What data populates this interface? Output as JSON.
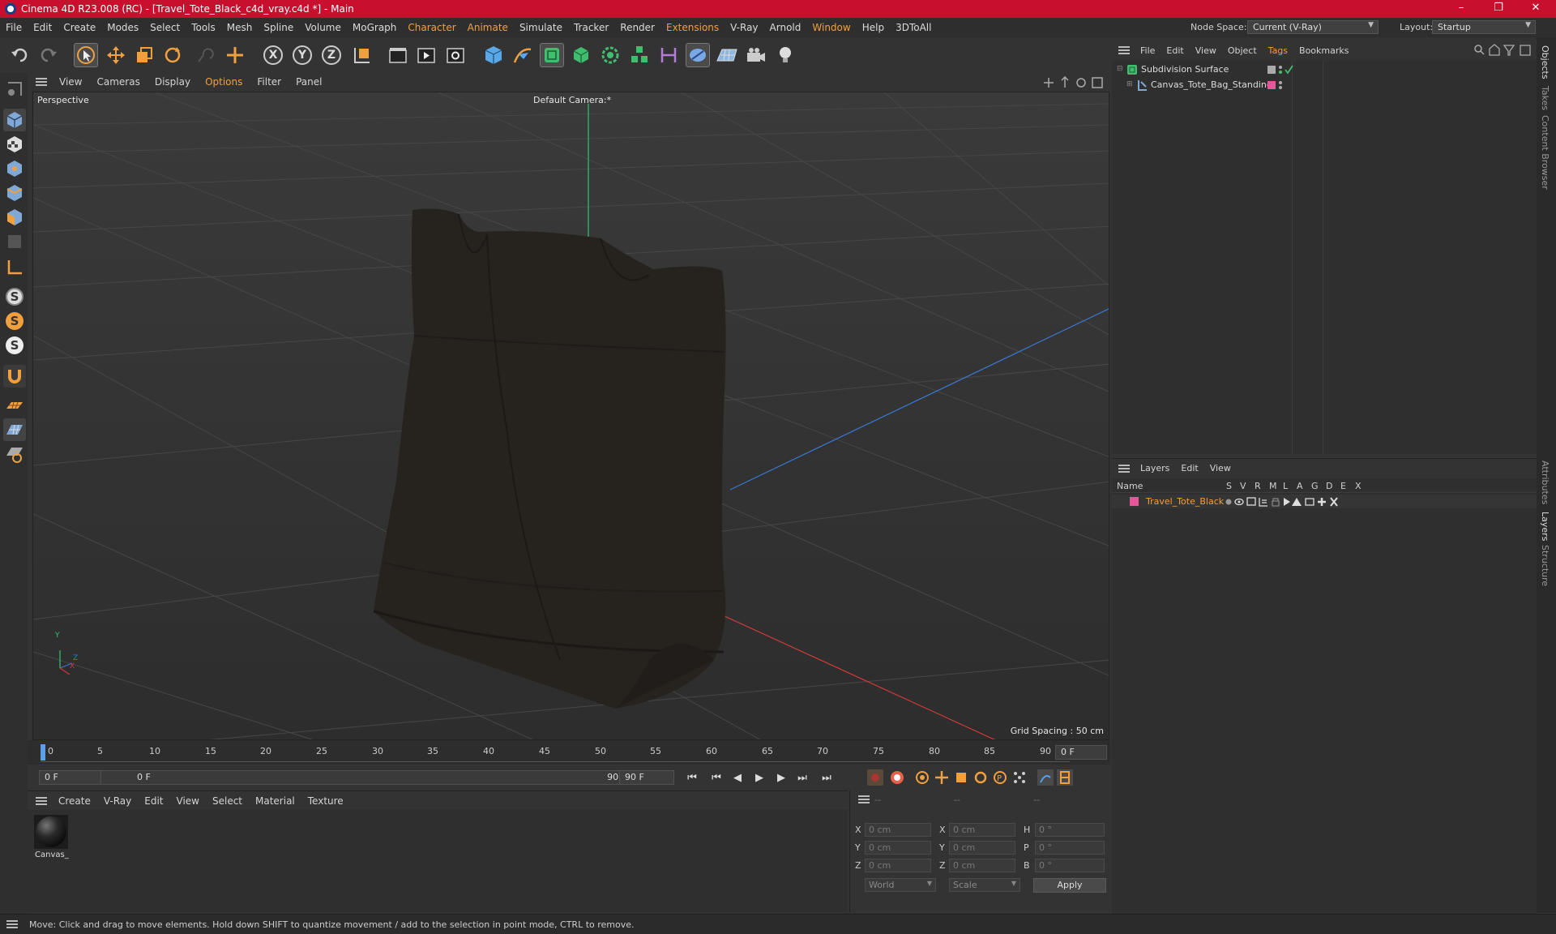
{
  "window": {
    "title": "Cinema 4D R23.008 (RC) - [Travel_Tote_Black_c4d_vray.c4d *] - Main",
    "minimize": "–",
    "restore": "❐",
    "close": "✕"
  },
  "menubar": {
    "items": [
      "File",
      "Edit",
      "Create",
      "Modes",
      "Select",
      "Tools",
      "Mesh",
      "Spline",
      "Volume",
      "MoGraph",
      "Character",
      "Animate",
      "Simulate",
      "Tracker",
      "Render",
      "Extensions",
      "V-Ray",
      "Arnold",
      "Window",
      "Help",
      "3DToAll"
    ],
    "node_space_label": "Node Space:",
    "node_space_value": "Current (V-Ray)",
    "layout_label": "Layout:",
    "layout_value": "Startup"
  },
  "toolbar": {
    "x_label": "X",
    "y_label": "Y",
    "z_label": "Z"
  },
  "viewport_menu": {
    "items": [
      "View",
      "Cameras",
      "Display",
      "Options",
      "Filter",
      "Panel"
    ]
  },
  "viewport": {
    "name": "Perspective",
    "camera": "Default Camera",
    "camera_mark": ":*",
    "grid_spacing": "Grid Spacing : 50 cm",
    "axis_y": "Y",
    "axis_z": "Z",
    "axis_x": "X"
  },
  "timeline": {
    "ticks": [
      "0",
      "5",
      "10",
      "15",
      "20",
      "25",
      "30",
      "35",
      "40",
      "45",
      "50",
      "55",
      "60",
      "65",
      "70",
      "75",
      "80",
      "85",
      "90"
    ],
    "current_frame": "0 F"
  },
  "transport": {
    "start_field": "0 F",
    "range_start": "0 F",
    "range_end": "90 F",
    "end_field": "90 F"
  },
  "material_menu": {
    "items": [
      "Create",
      "V-Ray",
      "Edit",
      "View",
      "Select",
      "Material",
      "Texture"
    ],
    "material_name": "Canvas_"
  },
  "coordinates": {
    "header": [
      "--",
      "--",
      "--"
    ],
    "pos_labels": [
      "X",
      "Y",
      "Z"
    ],
    "pos_values": [
      "0 cm",
      "0 cm",
      "0 cm"
    ],
    "size_labels": [
      "X",
      "Y",
      "Z"
    ],
    "size_values": [
      "0 cm",
      "0 cm",
      "0 cm"
    ],
    "rot_labels": [
      "H",
      "P",
      "B"
    ],
    "rot_values": [
      "0 °",
      "0 °",
      "0 °"
    ],
    "mode_world": "World",
    "mode_scale": "Scale",
    "apply": "Apply"
  },
  "object_manager": {
    "menu": [
      "File",
      "Edit",
      "View",
      "Object",
      "Tags",
      "Bookmarks"
    ],
    "objects": [
      "Subdivision Surface",
      "Canvas_Tote_Bag_Standing"
    ]
  },
  "layer_manager": {
    "menu": [
      "Layers",
      "Edit",
      "View"
    ],
    "columns": [
      "Name",
      "S",
      "V",
      "R",
      "M",
      "L",
      "A",
      "G",
      "D",
      "E",
      "X"
    ],
    "layer_name": "Travel_Tote_Black",
    "layer_color": "#e8569a"
  },
  "side_tabs": [
    "Objects",
    "Takes",
    "Content Browser",
    "Attributes",
    "Layers",
    "Structure"
  ],
  "status": "Move: Click and drag to move elements. Hold down SHIFT to quantize movement / add to the selection in point mode, CTRL to remove.",
  "colors": {
    "accent": "#f1a040",
    "titlebar": "#c8102e"
  }
}
